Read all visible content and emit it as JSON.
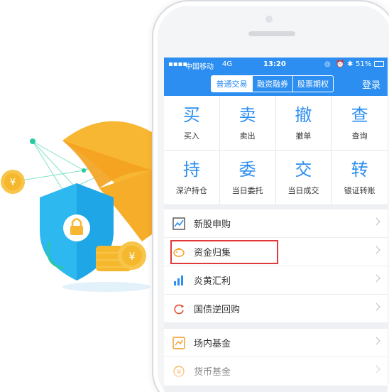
{
  "status": {
    "carrier": "中国移动",
    "network": "4G",
    "time": "13:20",
    "battery": "51%"
  },
  "header": {
    "tabs": [
      "普通交易",
      "融资融券",
      "股票期权"
    ],
    "login_label": "登录"
  },
  "grid": [
    {
      "big": "买",
      "label": "买入"
    },
    {
      "big": "卖",
      "label": "卖出"
    },
    {
      "big": "撤",
      "label": "撤单"
    },
    {
      "big": "查",
      "label": "查询"
    },
    {
      "big": "持",
      "label": "深沪持仓"
    },
    {
      "big": "委",
      "label": "当日委托"
    },
    {
      "big": "交",
      "label": "当日成交"
    },
    {
      "big": "转",
      "label": "银证转账"
    }
  ],
  "list1": [
    {
      "label": "新股申购",
      "icon": "chart-trend-icon"
    },
    {
      "label": "资金归集",
      "icon": "piggy-bank-icon"
    },
    {
      "label": "炎黄汇利",
      "icon": "bar-chart-icon"
    },
    {
      "label": "国债逆回购",
      "icon": "repo-cycle-icon"
    }
  ],
  "list2": [
    {
      "label": "场内基金",
      "icon": "fund-icon"
    },
    {
      "label": "货币基金",
      "icon": "money-fund-icon"
    }
  ],
  "colors": {
    "brand": "#2b8ef0",
    "highlight": "#e03a3a",
    "gold": "#f7b733"
  }
}
